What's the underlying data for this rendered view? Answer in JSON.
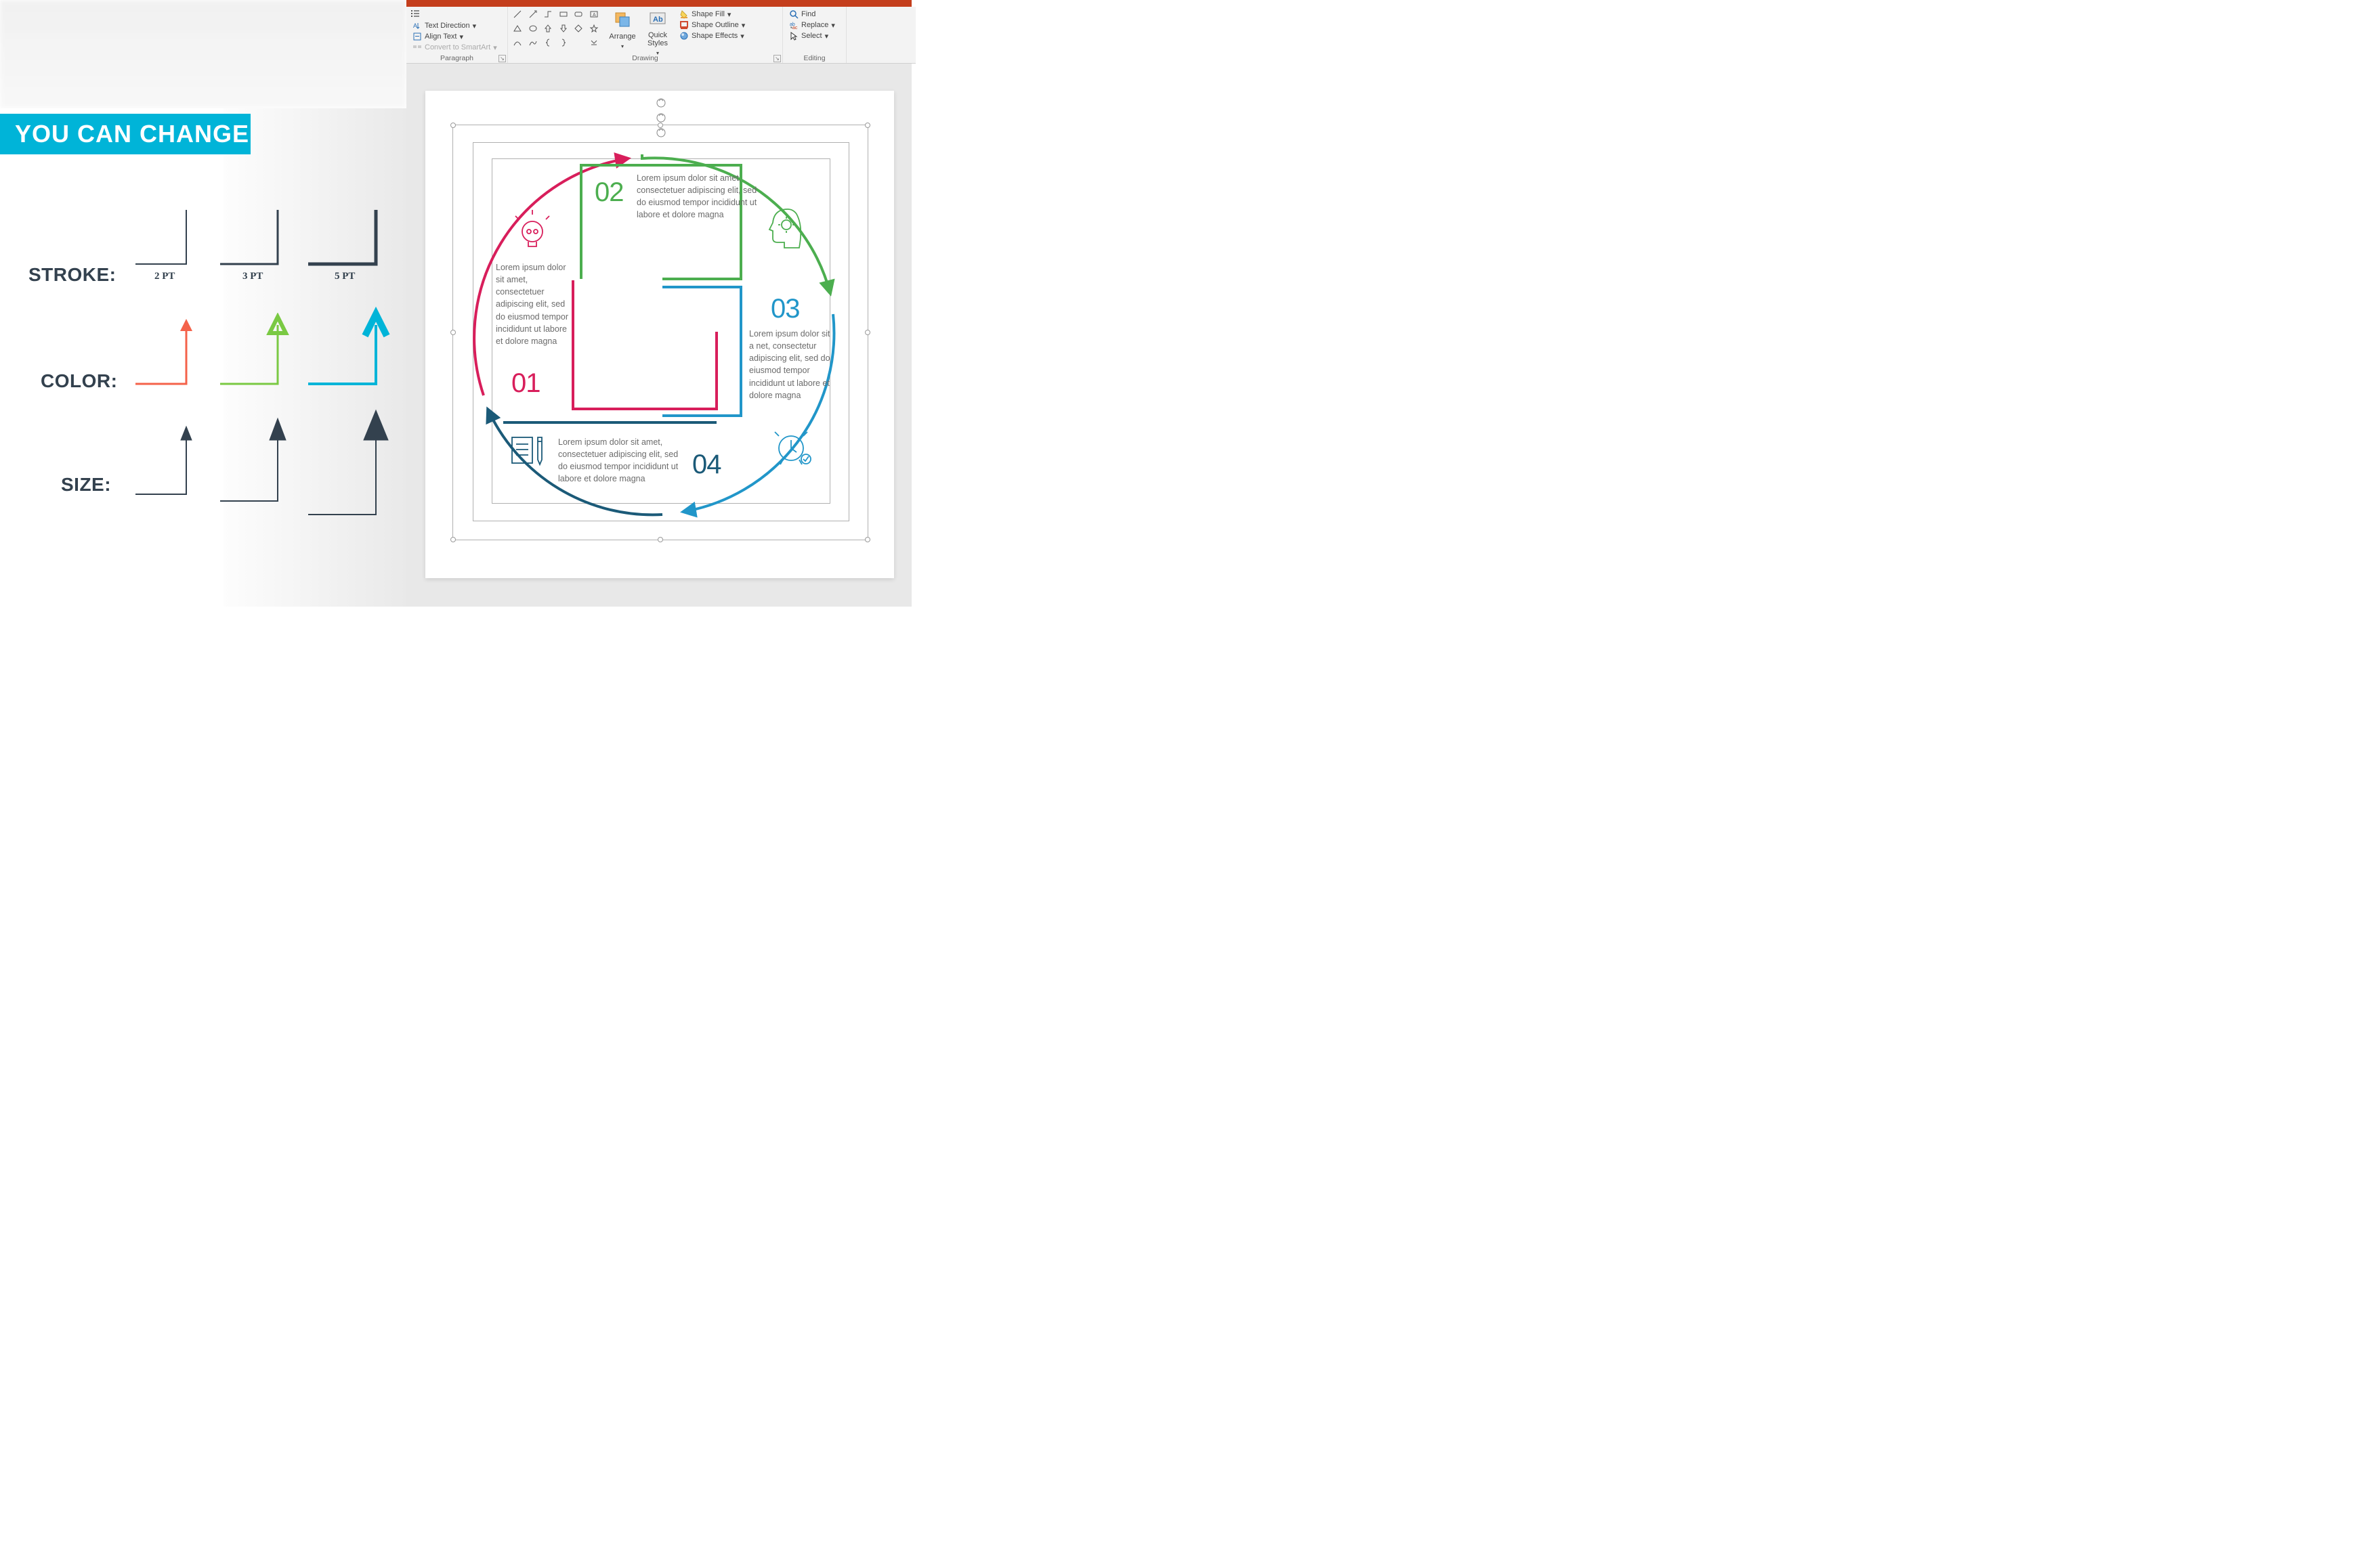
{
  "title": "YOU CAN CHANGE",
  "legend": {
    "stroke": {
      "label": "STROKE:",
      "opts": [
        "2 PT",
        "3 PT",
        "5 PT"
      ]
    },
    "color": {
      "label": "COLOR:"
    },
    "size": {
      "label": "SIZE:"
    }
  },
  "ribbon": {
    "paragraph": {
      "label": "Paragraph",
      "text_direction": "Text Direction",
      "align_text": "Align Text",
      "convert_smartart": "Convert to SmartArt"
    },
    "drawing": {
      "label": "Drawing",
      "arrange": "Arrange",
      "quick_styles": "Quick\nStyles",
      "shape_fill": "Shape Fill",
      "shape_outline": "Shape Outline",
      "shape_effects": "Shape Effects"
    },
    "editing": {
      "label": "Editing",
      "find": "Find",
      "replace": "Replace",
      "select": "Select"
    }
  },
  "slide": {
    "segments": [
      {
        "num": "01",
        "color": "#d81e5b",
        "text": "Lorem ipsum dolor sit amet, consectetuer adipiscing elit, sed do eiusmod tempor incididunt ut labore et dolore magna"
      },
      {
        "num": "02",
        "color": "#4cae4f",
        "text": "Lorem ipsum dolor sit amet, consectetuer adipiscing elit, sed do eiusmod tempor incididunt ut labore et dolore magna"
      },
      {
        "num": "03",
        "color": "#2196c9",
        "text": "Lorem ipsum dolor sit a net, consectetur adipiscing elit, sed do eiusmod tempor incididunt ut labore et dolore magna"
      },
      {
        "num": "04",
        "color": "#1b5a78",
        "text": "Lorem ipsum dolor sit amet, consectetuer adipiscing elit, sed do eiusmod tempor incididunt ut labore et dolore magna"
      }
    ]
  },
  "colors": {
    "cyan": "#00b4d8",
    "red": "#f4624a",
    "green": "#7ac943",
    "dark": "#33414e"
  }
}
